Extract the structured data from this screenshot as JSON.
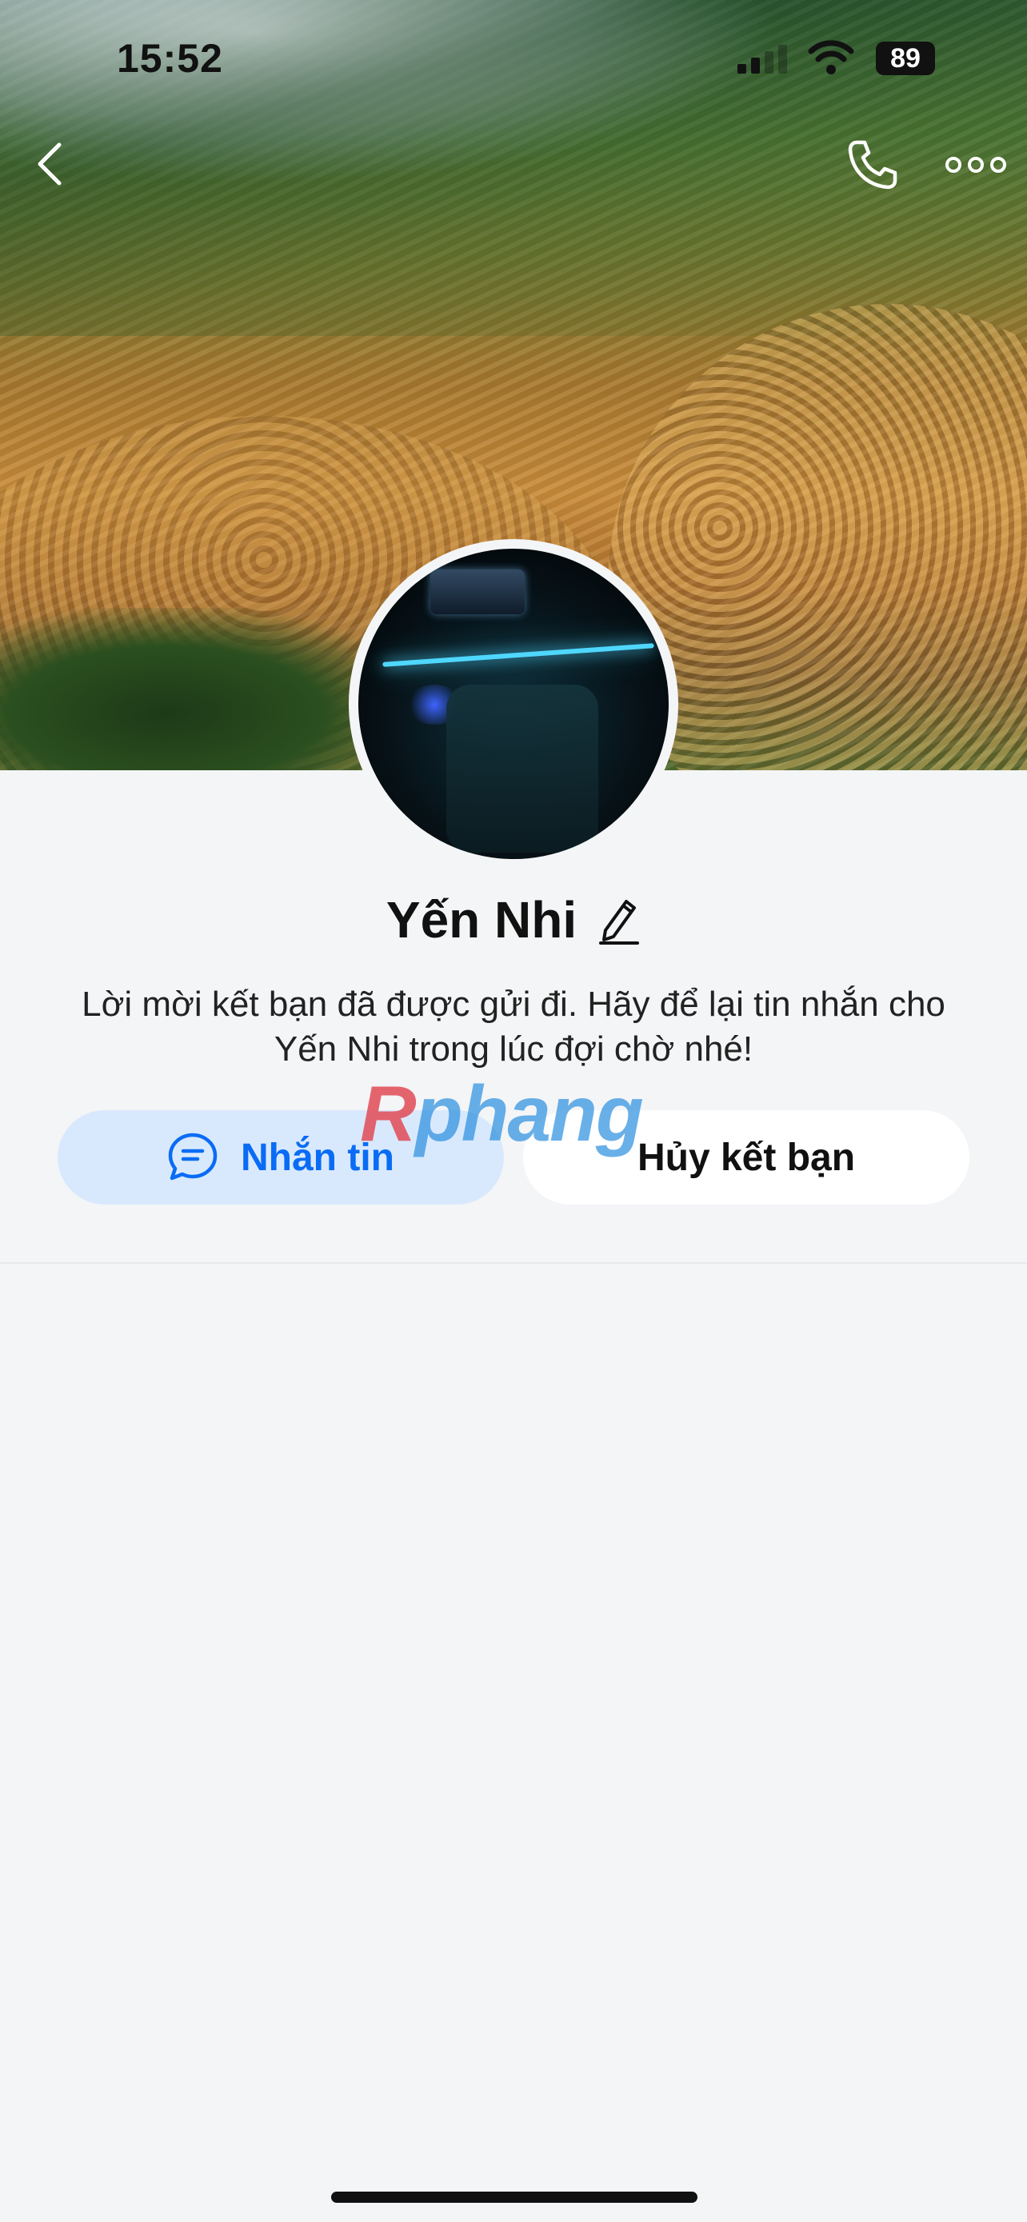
{
  "status_bar": {
    "time": "15:52",
    "battery": "89"
  },
  "profile": {
    "name": "Yến Nhi",
    "description": "Lời mời kết bạn đã được gửi đi. Hãy để lại tin nhắn cho Yến Nhi trong lúc đợi chờ nhé!"
  },
  "actions": {
    "message_label": "Nhắn tin",
    "unfriend_label": "Hủy kết bạn"
  },
  "watermark": {
    "first": "R",
    "rest": "phang"
  },
  "colors": {
    "accent": "#0a6cf5",
    "message_button_bg": "#d9e9fd",
    "page_bg": "#f4f5f7"
  },
  "icons": {
    "back": "back-icon",
    "call": "phone-icon",
    "more": "more-icon",
    "edit": "edit-pencil-icon",
    "chat": "chat-bubble-icon"
  }
}
